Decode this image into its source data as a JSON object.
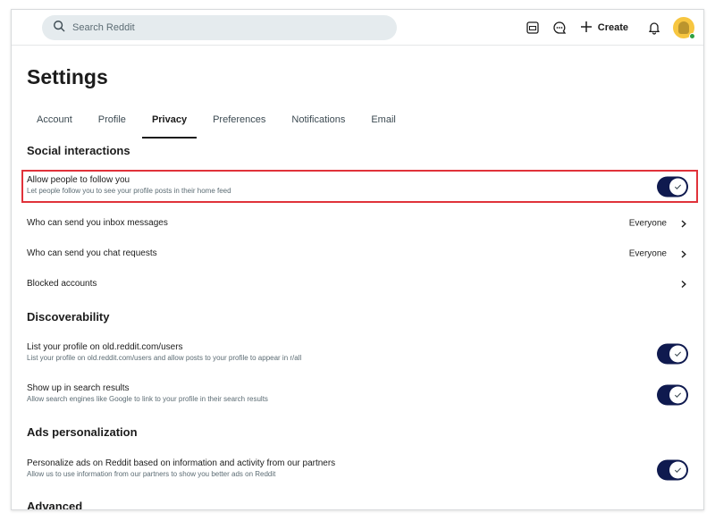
{
  "search": {
    "placeholder": "Search Reddit"
  },
  "header": {
    "create_label": "Create"
  },
  "icons": {
    "search": "search-icon",
    "ads": "advertise-icon",
    "chat": "chat-icon",
    "plus": "plus-icon",
    "bell": "bell-icon",
    "chevron": "chevron-right-icon",
    "check": "checkmark-icon"
  },
  "colors": {
    "toggle_on": "#0f1a4f",
    "highlight": "#e0323a",
    "search_bg": "#e5ebee"
  },
  "page": {
    "title": "Settings"
  },
  "tabs": [
    {
      "label": "Account",
      "active": false
    },
    {
      "label": "Profile",
      "active": false
    },
    {
      "label": "Privacy",
      "active": true
    },
    {
      "label": "Preferences",
      "active": false
    },
    {
      "label": "Notifications",
      "active": false
    },
    {
      "label": "Email",
      "active": false
    }
  ],
  "sections": {
    "social": {
      "title": "Social interactions",
      "follow": {
        "title": "Allow people to follow you",
        "subtitle": "Let people follow you to see your profile posts in their home feed",
        "enabled": true
      },
      "inbox": {
        "title": "Who can send you inbox messages",
        "value": "Everyone"
      },
      "chat": {
        "title": "Who can send you chat requests",
        "value": "Everyone"
      },
      "blocked": {
        "title": "Blocked accounts"
      }
    },
    "discover": {
      "title": "Discoverability",
      "old_reddit": {
        "title": "List your profile on old.reddit.com/users",
        "subtitle": "List your profile on old.reddit.com/users and allow posts to your profile to appear in r/all",
        "enabled": true
      },
      "search": {
        "title": "Show up in search results",
        "subtitle": "Allow search engines like Google to link to your profile in their search results",
        "enabled": true
      }
    },
    "ads": {
      "title": "Ads personalization",
      "partners": {
        "title": "Personalize ads on Reddit based on information and activity from our partners",
        "subtitle": "Allow us to use information from our partners to show you better ads on Reddit",
        "enabled": true
      }
    },
    "advanced": {
      "title": "Advanced"
    }
  }
}
